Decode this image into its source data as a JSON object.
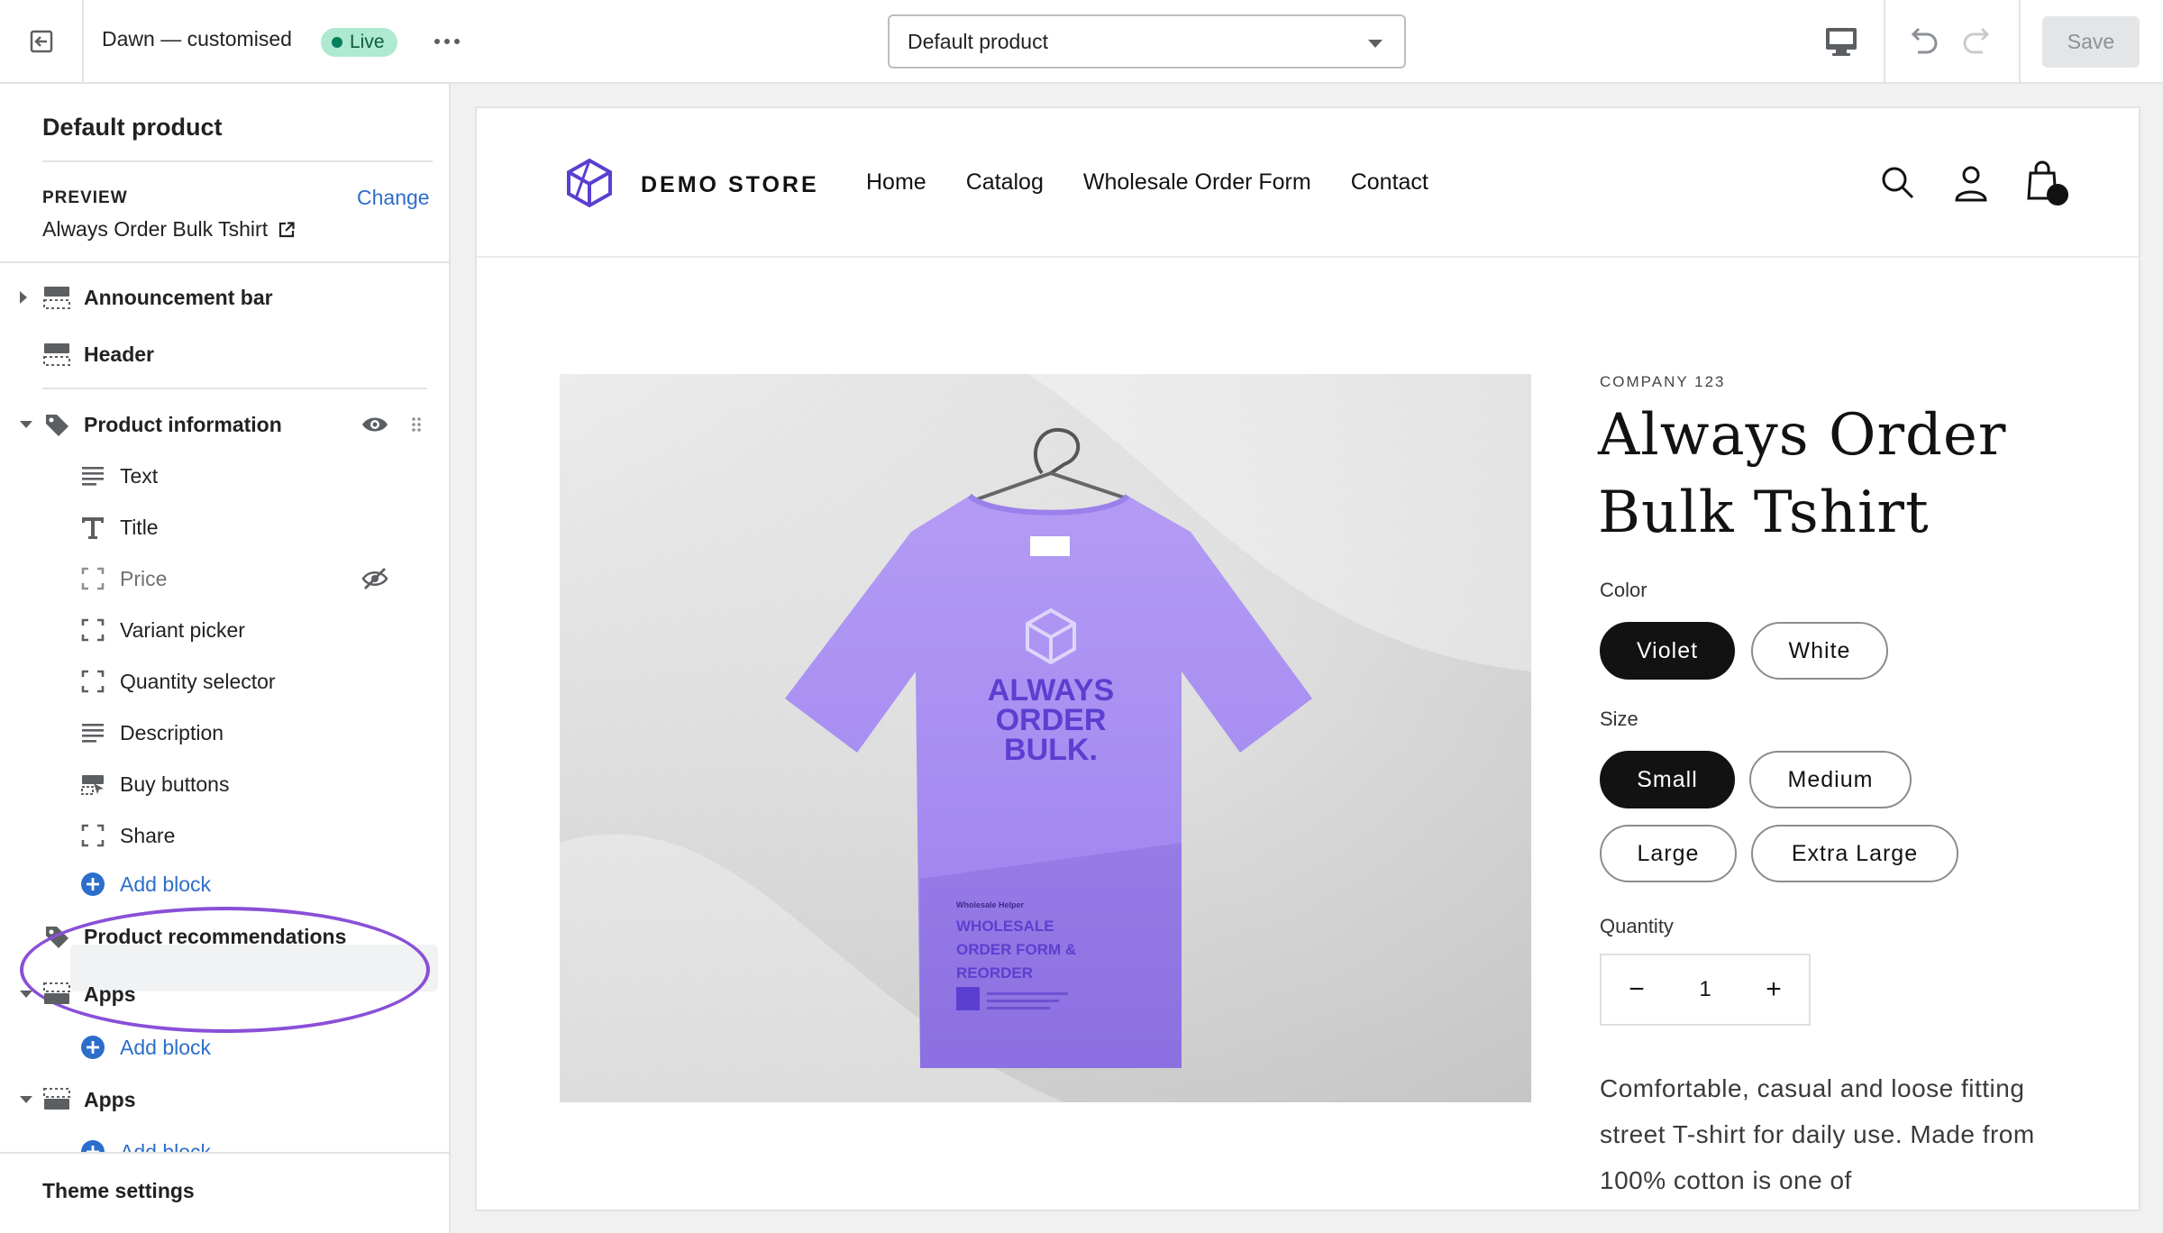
{
  "topbar": {
    "theme_name": "Dawn — customised",
    "live_badge": "Live",
    "template_select": "Default product",
    "save_label": "Save"
  },
  "sidebar": {
    "title": "Default product",
    "preview_label": "PREVIEW",
    "preview_change": "Change",
    "preview_value": "Always Order Bulk Tshirt",
    "sections": [
      {
        "label": "Announcement bar",
        "icon": "section-icon",
        "collapsed": true
      },
      {
        "label": "Header",
        "icon": "section-icon"
      },
      {
        "label": "Product information",
        "icon": "tag-icon",
        "expanded": true,
        "blocks": [
          {
            "label": "Text",
            "icon": "text-lines-icon"
          },
          {
            "label": "Title",
            "icon": "title-t-icon"
          },
          {
            "label": "Price",
            "icon": "dashed-square-icon",
            "hidden": true
          },
          {
            "label": "Variant picker",
            "icon": "dashed-square-icon"
          },
          {
            "label": "Quantity selector",
            "icon": "dashed-square-icon"
          },
          {
            "label": "Description",
            "icon": "text-lines-icon"
          },
          {
            "label": "Buy buttons",
            "icon": "buy-buttons-icon"
          },
          {
            "label": "Share",
            "icon": "dashed-square-icon"
          }
        ],
        "add_block": "Add block"
      },
      {
        "label": "Product recommendations",
        "icon": "tag-icon"
      },
      {
        "label": "Apps",
        "icon": "section-icon",
        "expanded": true,
        "add_block": "Add block"
      },
      {
        "label": "Apps",
        "icon": "section-icon",
        "expanded": true,
        "add_block": "Add block"
      }
    ],
    "footer": "Theme settings"
  },
  "store": {
    "logo_text": "DEMO STORE",
    "nav": [
      "Home",
      "Catalog",
      "Wholesale Order Form",
      "Contact"
    ],
    "vendor": "COMPANY 123",
    "product_title": "Always Order Bulk Tshirt",
    "tshirt_text": "ALWAYS ORDER BULK.",
    "tshirt_small_heading": "Wholesale Helper",
    "tshirt_small_title": "WHOLESALE ORDER FORM & REORDER",
    "color_label": "Color",
    "colors": [
      "Violet",
      "White"
    ],
    "size_label": "Size",
    "sizes": [
      "Small",
      "Medium",
      "Large",
      "Extra Large"
    ],
    "quantity_label": "Quantity",
    "quantity_minus": "−",
    "quantity_value": "1",
    "quantity_plus": "+",
    "description": "Comfortable, casual and loose fitting street T-shirt for daily use. Made from 100% cotton is one of"
  },
  "colors": {
    "accent": "#2c6ecb",
    "live_badge_bg": "#aee9d1",
    "highlight_ring": "#8a4fd8",
    "tshirt": "#a98ef0",
    "logo": "#5b3fd0"
  }
}
